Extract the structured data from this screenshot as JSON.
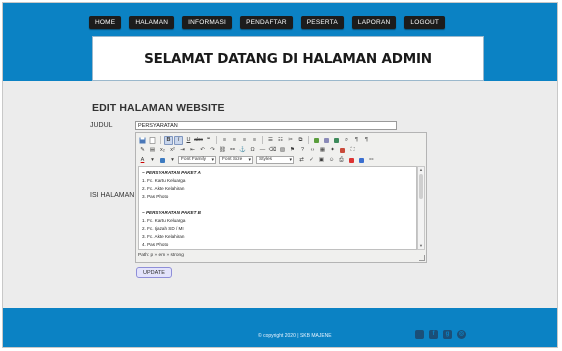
{
  "nav": {
    "items": [
      "HOME",
      "HALAMAN",
      "INFORMASI",
      "PENDAFTAR",
      "PESERTA",
      "LAPORAN",
      "LOGOUT"
    ]
  },
  "header": {
    "welcome": "SELAMAT DATANG DI HALAMAN ADMIN"
  },
  "main": {
    "title": "EDIT HALAMAN WEBSITE",
    "judul_label": "JUDUL",
    "judul_value": "PERSYARATAN",
    "isi_label": "ISI HALAMAN"
  },
  "editor": {
    "font_family": "Font Family",
    "font_size": "Font Size",
    "styles": "Styles",
    "content": [
      "~ PERSYARATAN PAKET A",
      "1. Fc. Kartu Keluarga",
      "2. Fc. Akte Kelahiran",
      "3. Pas Photo",
      "",
      "~ PERSYARATAN PAKET B",
      "1. Fc. Kartu Keluarga",
      "2. Fc. Ijazah SD / MI",
      "3. Fc. Akte Kelahiran",
      "4. Pas Photo"
    ],
    "status": "Path: p » em » strong"
  },
  "update_label": "UPDATE",
  "footer": {
    "copyright": "© copyright 2020 | SKB MAJENE"
  },
  "colors": {
    "brand_blue": "#0b82c4",
    "nav_dark": "#1c1c1c",
    "social_icon": "#1b4f78"
  },
  "social_icons": [
    "twitter-icon",
    "facebook-icon",
    "google-plus-icon",
    "instagram-icon"
  ]
}
